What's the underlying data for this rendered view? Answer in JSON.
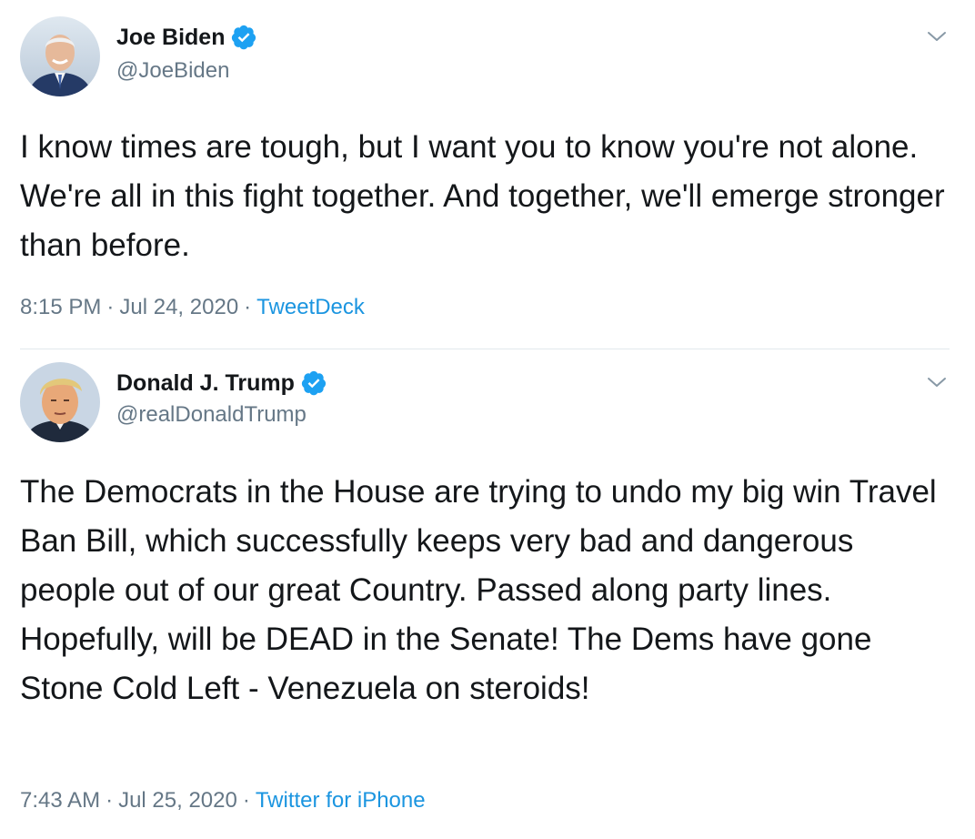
{
  "tweets": [
    {
      "name": "Joe Biden",
      "handle": "@JoeBiden",
      "text": "I know times are tough, but I want you to know you're not alone. We're all in this fight together. And together, we'll emerge stronger than before.",
      "time": "8:15 PM",
      "date": "Jul 24, 2020",
      "source": "TweetDeck"
    },
    {
      "name": "Donald J. Trump",
      "handle": "@realDonaldTrump",
      "text": "The Democrats in the House are trying to undo my big win Travel Ban Bill, which successfully keeps very bad and dangerous people out of our great Country. Passed along party lines. Hopefully, will be DEAD in the Senate! The Dems have gone Stone Cold Left - Venezuela on steroids!",
      "time": "7:43 AM",
      "date": "Jul 25, 2020",
      "source": "Twitter for iPhone"
    }
  ],
  "separator": "·",
  "colors": {
    "link": "#1b95e0",
    "muted": "#657786",
    "verified": "#1da1f2",
    "text": "#14171a",
    "divider": "#e1e8ed"
  },
  "icons": [
    "verified-badge-icon",
    "chevron-down-icon",
    "avatar"
  ]
}
